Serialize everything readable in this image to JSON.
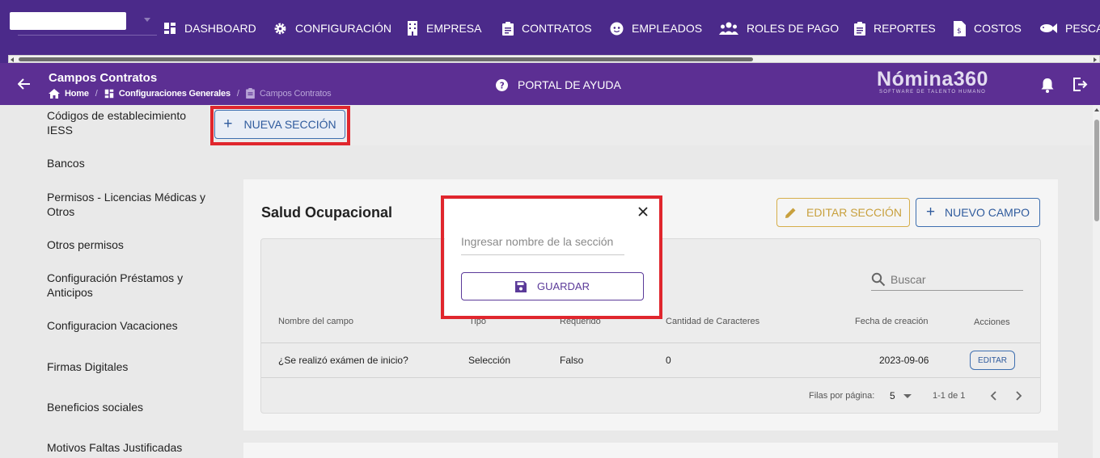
{
  "topnav": {
    "items": [
      {
        "label": "DASHBOARD",
        "icon": "dashboard-icon"
      },
      {
        "label": "CONFIGURACIÓN",
        "icon": "gear-icon"
      },
      {
        "label": "EMPRESA",
        "icon": "building-icon"
      },
      {
        "label": "CONTRATOS",
        "icon": "clipboard-icon"
      },
      {
        "label": "EMPLEADOS",
        "icon": "face-icon"
      },
      {
        "label": "ROLES DE PAGO",
        "icon": "users-icon"
      },
      {
        "label": "REPORTES",
        "icon": "report-icon"
      },
      {
        "label": "COSTOS",
        "icon": "invoice-icon"
      },
      {
        "label": "PESCA",
        "icon": "fish-icon"
      }
    ]
  },
  "header": {
    "title": "Campos Contratos",
    "breadcrumb": [
      {
        "label": "Home",
        "icon": "home-icon"
      },
      {
        "label": "Configuraciones Generales",
        "icon": "dashboard-icon"
      },
      {
        "label": "Campos Contratos",
        "icon": "clipboard-icon"
      }
    ],
    "help_label": "PORTAL DE AYUDA",
    "logo_main": "Nómina360",
    "logo_sub": "SOFTWARE DE TALENTO HUMANO"
  },
  "sidebar": {
    "items": [
      {
        "label": "Códigos de establecimiento IESS"
      },
      {
        "label": "Bancos"
      },
      {
        "label": "Permisos - Licencias Médicas y Otros"
      },
      {
        "label": "Otros permisos"
      },
      {
        "label": "Configuración Préstamos y Anticipos"
      },
      {
        "label": "Configuracion Vacaciones"
      },
      {
        "label": "Firmas Digitales"
      },
      {
        "label": "Beneficios sociales"
      },
      {
        "label": "Motivos Faltas Justificadas"
      }
    ]
  },
  "main": {
    "new_section_label": "NUEVA SECCIÓN",
    "section": {
      "title": "Salud Ocupacional",
      "edit_section_label": "EDITAR SECCIÓN",
      "new_field_label": "NUEVO CAMPO",
      "search_placeholder": "Buscar",
      "columns": [
        "Nombre del campo",
        "Tipo",
        "Requerido",
        "Cantidad de Caracteres",
        "Fecha de creación",
        "Acciones"
      ],
      "rows": [
        {
          "nombre": "¿Se realizó exámen de inicio?",
          "tipo": "Selección",
          "requerido": "Falso",
          "cantidad": "0",
          "fecha": "2023-09-06",
          "accion": "EDITAR"
        }
      ],
      "pagination": {
        "rows_per_page_label": "Filas por página:",
        "rows_per_page": "5",
        "range": "1-1 de 1"
      }
    }
  },
  "modal": {
    "input_placeholder": "Ingresar nombre de la sección",
    "save_label": "GUARDAR"
  },
  "colors": {
    "nav_bg": "#4b2a8a",
    "subheader_bg": "#5c2f93",
    "primary_blue": "#2f5b9d",
    "warning_gold": "#c8a03d",
    "highlight_red": "#e0262d"
  }
}
